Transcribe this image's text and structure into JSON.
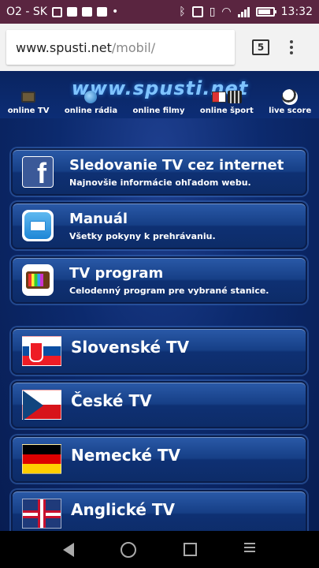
{
  "status_bar": {
    "carrier": "O2 - SK",
    "time": "13:32",
    "battery_percent": 85
  },
  "browser": {
    "url_host": "www.spusti.net",
    "url_path": "/mobil/",
    "tab_count": "5"
  },
  "site": {
    "logo": "www.spusti.net",
    "nav": [
      {
        "label": "online TV"
      },
      {
        "label": "online rádia"
      },
      {
        "label": "online filmy"
      },
      {
        "label": "online šport"
      },
      {
        "label": "live score"
      }
    ]
  },
  "menu": [
    {
      "title": "Sledovanie TV cez internet",
      "subtitle": "Najnovšie informácie ohľadom webu.",
      "icon": "facebook-icon"
    },
    {
      "title": "Manuál",
      "subtitle": "Všetky pokyny k prehrávaniu.",
      "icon": "book-icon"
    },
    {
      "title": "TV program",
      "subtitle": "Celodenný program pre vybrané stanice.",
      "icon": "tv-icon"
    }
  ],
  "countries": [
    {
      "title": "Slovenské TV"
    },
    {
      "title": "České TV"
    },
    {
      "title": "Nemecké TV"
    },
    {
      "title": "Anglické TV"
    }
  ]
}
